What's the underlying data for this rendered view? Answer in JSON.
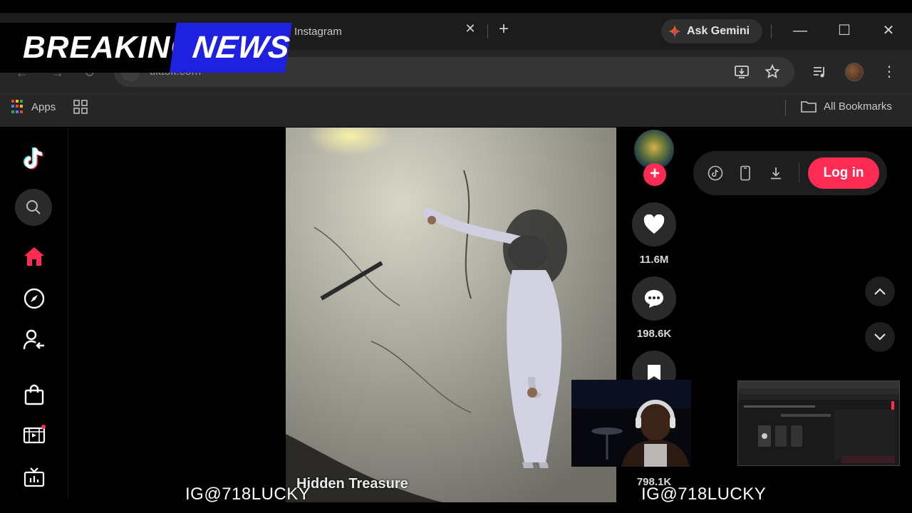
{
  "overlay": {
    "breaking_word": "BREAKING",
    "news_word": "NEWS",
    "watermark_left": "IG@718LUCKY",
    "watermark_right": "IG@718LUCKY"
  },
  "browser": {
    "active_tab_title": "Instagram",
    "tab_close_glyph": "✕",
    "new_tab_glyph": "+",
    "gemini_label": "Ask Gemini",
    "url": "tiktok.com",
    "bookmarks": {
      "apps_label": "Apps",
      "all_bookmarks_label": "All Bookmarks"
    },
    "window_controls": [
      "—",
      "☐",
      "✕"
    ]
  },
  "tiktok": {
    "login_label": "Log in",
    "follow_glyph": "+",
    "likes_count": "11.6M",
    "comments_count": "198.6K",
    "shares_count": "798.1K",
    "video_caption": "Hidden Treasure",
    "sidebar_icons": [
      "tiktok-logo-icon",
      "search-icon",
      "home-icon",
      "explore-compass-icon",
      "following-icon",
      "shop-bag-icon",
      "live-video-icon",
      "tv-icon"
    ],
    "pill_icons": [
      "tiktok-circle-icon",
      "phone-icon",
      "download-icon"
    ]
  },
  "colors": {
    "accent": "#fe2c55",
    "news_blue": "#1f21e0",
    "chrome_bg": "#262626"
  }
}
